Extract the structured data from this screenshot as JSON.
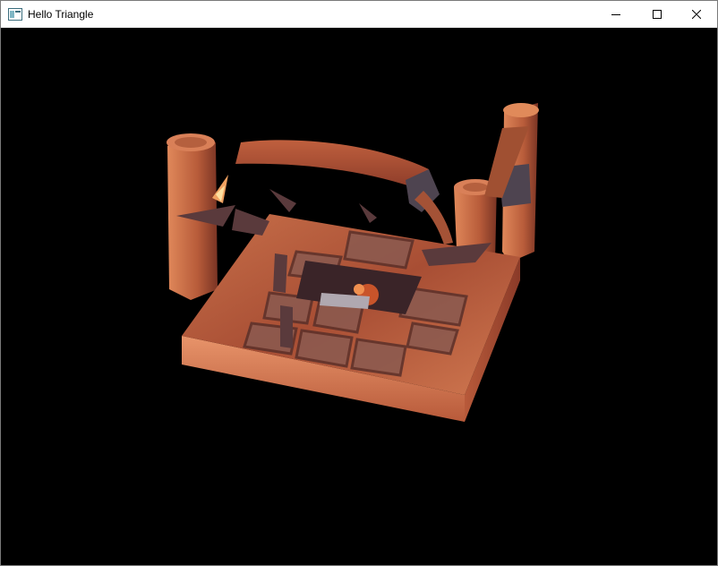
{
  "window": {
    "title": "Hello Triangle",
    "icon": "app-window-icon",
    "controls": {
      "minimize_icon": "minimize-icon",
      "maximize_icon": "maximize-icon",
      "close_icon": "close-icon"
    }
  },
  "viewport": {
    "background": "#000000",
    "content": "3d-rendered-scene"
  },
  "colors": {
    "titlebar_bg": "#ffffff",
    "wood_light": "#e08a5a",
    "wood_mid": "#b85a3a",
    "wood_dark": "#6b2a1e",
    "stone": "#7a5a5a",
    "metal": "#4a4048"
  }
}
